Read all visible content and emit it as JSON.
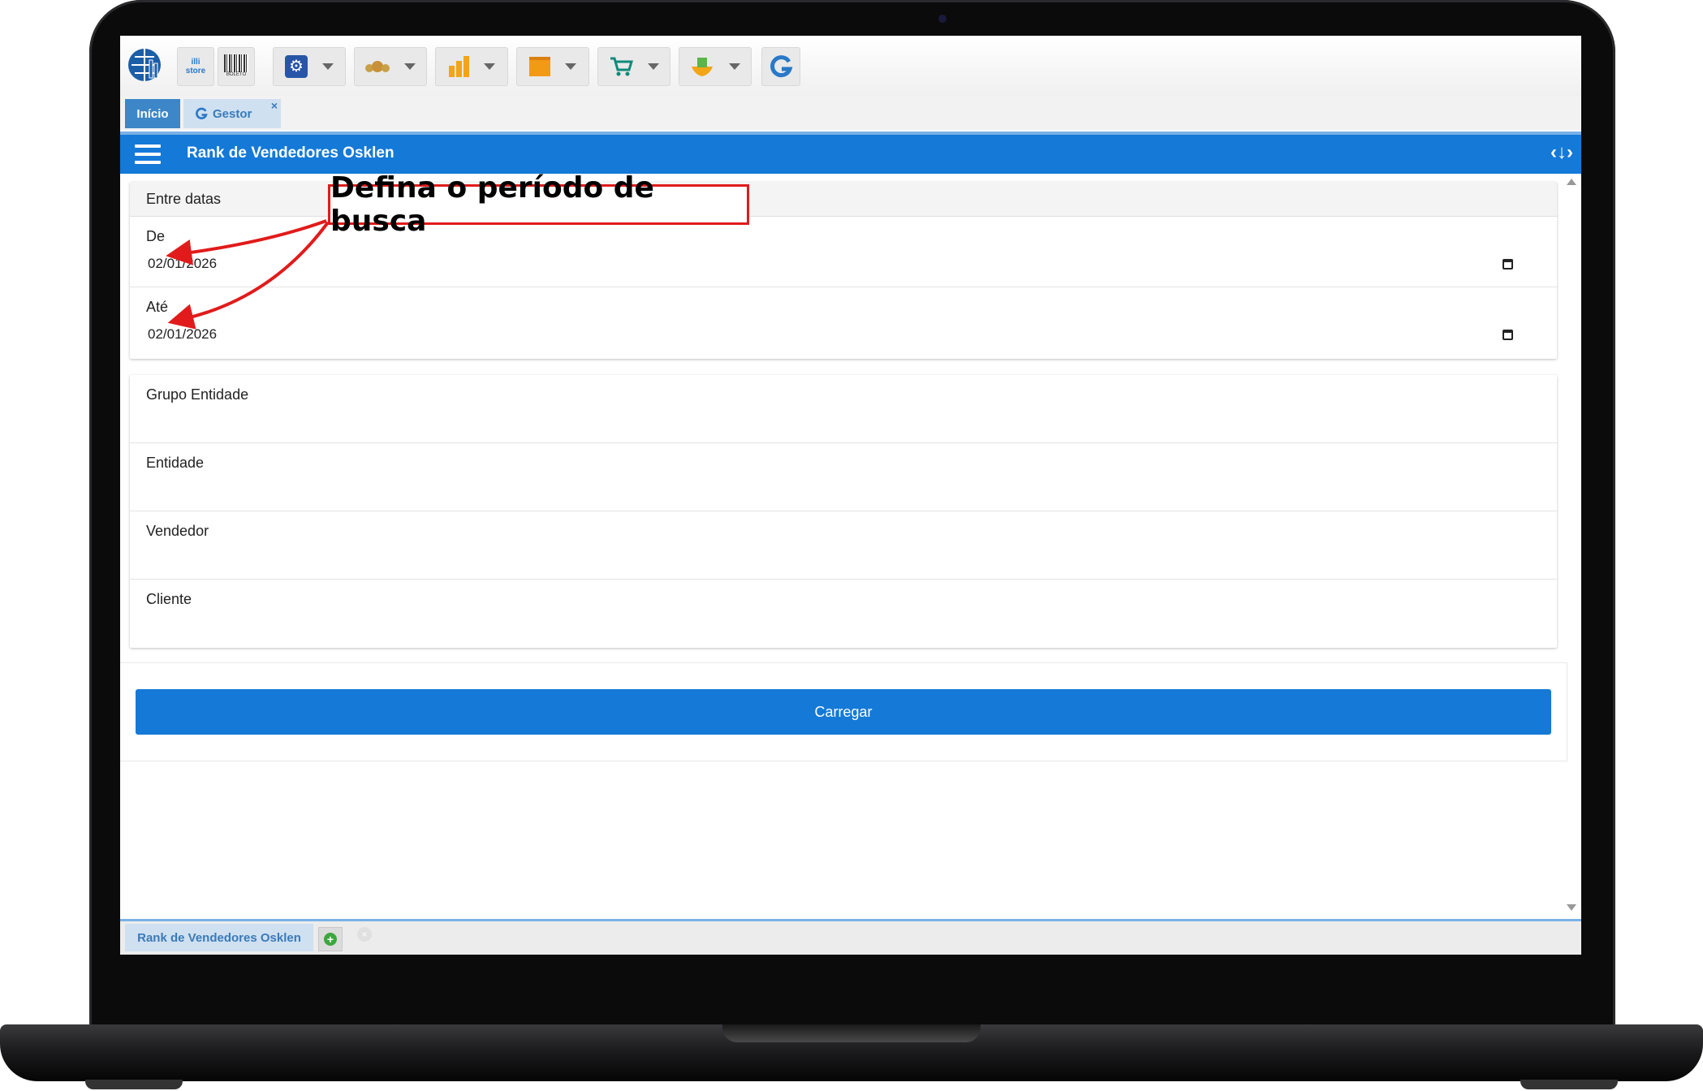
{
  "toolbar": {
    "buttons": [
      {
        "name": "store",
        "label": "illi store"
      },
      {
        "name": "boleto",
        "label": "BOLETO"
      },
      {
        "name": "settings"
      },
      {
        "name": "users"
      },
      {
        "name": "charts"
      },
      {
        "name": "box"
      },
      {
        "name": "cart"
      },
      {
        "name": "hands"
      },
      {
        "name": "refresh-g"
      }
    ]
  },
  "tabs": {
    "inicio": "Início",
    "gestor": "Gestor",
    "close_glyph": "×"
  },
  "header": {
    "title": "Rank de Vendedores Osklen",
    "right_icon": "‹↓›"
  },
  "dates": {
    "section_title": "Entre datas",
    "from_label": "De",
    "from_value": "02/01/2026",
    "to_label": "Até",
    "to_value": "02/01/2026"
  },
  "filters": {
    "group_label": "Grupo Entidade",
    "entity_label": "Entidade",
    "seller_label": "Vendedor",
    "client_label": "Cliente"
  },
  "actions": {
    "load_label": "Carregar"
  },
  "bottom_tabs": {
    "current": "Rank de Vendedores Osklen",
    "add_glyph": "+",
    "close_glyph": "×"
  },
  "annotation": {
    "callout_text": "Defina o período de busca"
  },
  "colors": {
    "primary": "#1479d7",
    "callout_border": "#e11b1b",
    "arrow": "#e11b1b"
  }
}
